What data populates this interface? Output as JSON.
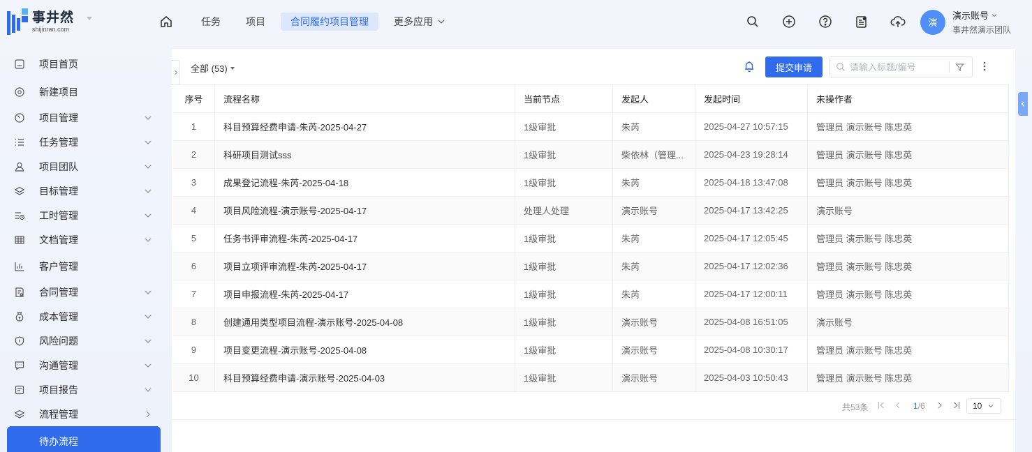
{
  "brand": {
    "name": "事井然",
    "site": "shijinran.com"
  },
  "nav": {
    "items": [
      "任务",
      "项目",
      "合同履约项目管理"
    ],
    "active_index": 2,
    "more": "更多应用"
  },
  "user": {
    "avatar_text": "演",
    "name": "演示账号",
    "team": "事井然演示团队"
  },
  "sidebar": {
    "items": [
      "项目首页",
      "新建项目",
      "项目管理",
      "任务管理",
      "项目团队",
      "目标管理",
      "工时管理",
      "文档管理",
      "客户管理",
      "合同管理",
      "成本管理",
      "风险问题",
      "沟通管理",
      "项目报告",
      "流程管理"
    ],
    "active": "待办流程"
  },
  "toolbar": {
    "filter": "全部 (53)",
    "submit": "提交申请",
    "search_placeholder": "请输入标题/编号"
  },
  "table": {
    "columns": [
      "序号",
      "流程名称",
      "当前节点",
      "发起人",
      "发起时间",
      "未操作者"
    ],
    "rows": [
      [
        "1",
        "科目预算经费申请-朱芮-2025-04-27",
        "1级审批",
        "朱芮",
        "2025-04-27 10:57:15",
        "管理员 演示账号 陈忠英"
      ],
      [
        "2",
        "科研项目测试sss",
        "1级审批",
        "柴依林（管理...",
        "2025-04-23 19:28:14",
        "管理员 演示账号 陈忠英"
      ],
      [
        "3",
        "成果登记流程-朱芮-2025-04-18",
        "1级审批",
        "朱芮",
        "2025-04-18 13:47:08",
        "管理员 演示账号 陈忠英"
      ],
      [
        "4",
        "项目风险流程-演示账号-2025-04-17",
        "处理人处理",
        "演示账号",
        "2025-04-17 13:42:25",
        "演示账号"
      ],
      [
        "5",
        "任务书评审流程-朱芮-2025-04-17",
        "1级审批",
        "朱芮",
        "2025-04-17 12:05:45",
        "管理员 演示账号 陈忠英"
      ],
      [
        "6",
        "项目立项评审流程-朱芮-2025-04-17",
        "1级审批",
        "朱芮",
        "2025-04-17 12:02:36",
        "管理员 演示账号 陈忠英"
      ],
      [
        "7",
        "项目申报流程-朱芮-2025-04-17",
        "1级审批",
        "朱芮",
        "2025-04-17 12:00:11",
        "管理员 演示账号 陈忠英"
      ],
      [
        "8",
        "创建通用类型项目流程-演示账号-2025-04-08",
        "1级审批",
        "演示账号",
        "2025-04-08 16:51:05",
        "演示账号"
      ],
      [
        "9",
        "项目变更流程-演示账号-2025-04-08",
        "1级审批",
        "演示账号",
        "2025-04-08 10:30:17",
        "管理员 演示账号 陈忠英"
      ],
      [
        "10",
        "科目预算经费申请-演示账号-2025-04-03",
        "1级审批",
        "演示账号",
        "2025-04-03 10:50:43",
        "管理员 演示账号 陈忠英"
      ]
    ]
  },
  "pager": {
    "total": "共53条",
    "current": "1",
    "pages": "/6",
    "page_size": "10"
  },
  "colors": {
    "accent": "#2f6bea",
    "accent_light": "#dde7fb",
    "background": "#eef2fb"
  }
}
